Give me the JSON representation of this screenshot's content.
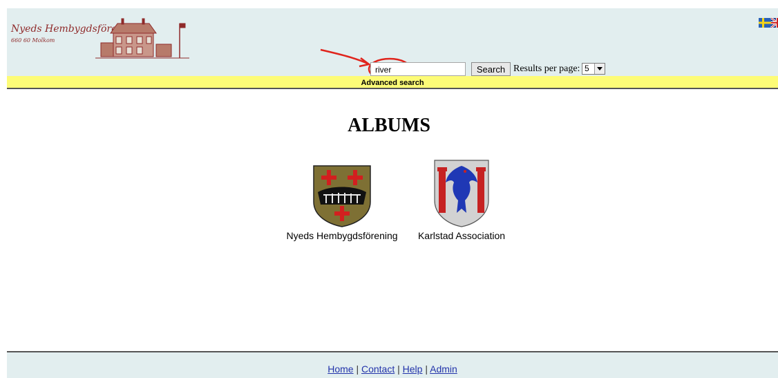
{
  "header": {
    "org_name": "Nyeds Hembygdsförening",
    "org_postal": "660 60 Molkom",
    "flags": [
      "sweden-flag-icon",
      "uk-flag-icon"
    ],
    "colors": {
      "background": "#e2eeef",
      "logo": "#8f2a2a"
    }
  },
  "search": {
    "value": "river",
    "button_label": "Search",
    "results_label": "Results per page:",
    "results_value": "5"
  },
  "advanced_search": {
    "label": "Advanced search",
    "bar_color": "#fdfc77"
  },
  "main": {
    "title": "ALBUMS",
    "albums": [
      {
        "name": "Nyeds Hembygdsförening",
        "icon": "nyed-coat-of-arms-icon"
      },
      {
        "name": "Karlstad Association",
        "icon": "karlstad-coat-of-arms-icon"
      }
    ]
  },
  "footer": {
    "links": [
      "Home",
      "Contact",
      "Help",
      "Admin"
    ],
    "separator": "|"
  }
}
